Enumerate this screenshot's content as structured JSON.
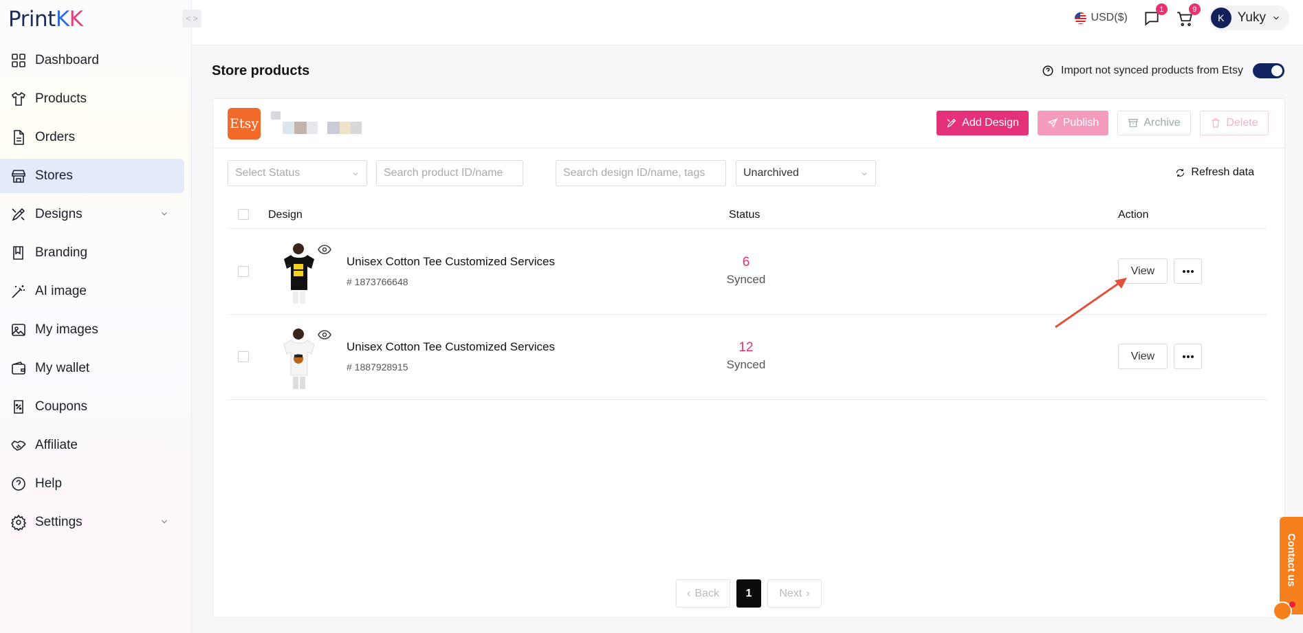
{
  "app": {
    "logo_main": "Print",
    "logo_k1": "K",
    "logo_k2": "K"
  },
  "sidebar": {
    "items": [
      {
        "label": "Dashboard",
        "icon": "dashboard-icon"
      },
      {
        "label": "Products",
        "icon": "tshirt-icon"
      },
      {
        "label": "Orders",
        "icon": "document-icon"
      },
      {
        "label": "Stores",
        "icon": "store-icon",
        "active": true
      },
      {
        "label": "Designs",
        "icon": "brush-icon",
        "expandable": true
      },
      {
        "label": "Branding",
        "icon": "book-icon"
      },
      {
        "label": "AI image",
        "icon": "magic-wand-icon"
      },
      {
        "label": "My images",
        "icon": "image-icon"
      },
      {
        "label": "My wallet",
        "icon": "wallet-icon"
      },
      {
        "label": "Coupons",
        "icon": "coupon-icon"
      },
      {
        "label": "Affiliate",
        "icon": "handshake-icon"
      },
      {
        "label": "Help",
        "icon": "help-icon"
      },
      {
        "label": "Settings",
        "icon": "gear-icon",
        "expandable": true
      }
    ]
  },
  "topbar": {
    "currency": "USD($)",
    "messages_count": "1",
    "cart_count": "9",
    "user_name": "Yuky",
    "avatar_initial": "K"
  },
  "page": {
    "title": "Store products",
    "import_label": "Import not synced products from Etsy",
    "import_enabled": true
  },
  "store": {
    "platform": "Etsy"
  },
  "actions": {
    "add_design": "Add Design",
    "publish": "Publish",
    "archive": "Archive",
    "delete": "Delete"
  },
  "filters": {
    "status_placeholder": "Select Status",
    "product_search_placeholder": "Search product ID/name",
    "design_search_placeholder": "Search design ID/name, tags",
    "archive_value": "Unarchived",
    "refresh": "Refresh data"
  },
  "table": {
    "headers": {
      "design": "Design",
      "status": "Status",
      "action": "Action"
    },
    "rows": [
      {
        "name": "Unisex Cotton Tee Customized Services",
        "id": "# 1873766648",
        "count": "6",
        "status": "Synced",
        "view": "View",
        "shirt_color": "#111111"
      },
      {
        "name": "Unisex Cotton Tee Customized Services",
        "id": "# 1887928915",
        "count": "12",
        "status": "Synced",
        "view": "View",
        "shirt_color": "#f4f4f4"
      }
    ]
  },
  "pagination": {
    "back": "Back",
    "current": "1",
    "next": "Next"
  },
  "contact": {
    "label": "Contact us"
  },
  "colors": {
    "accent": "#e5307a",
    "navy": "#122361",
    "etsy": "#f26a2a",
    "contact": "#f7801e"
  }
}
